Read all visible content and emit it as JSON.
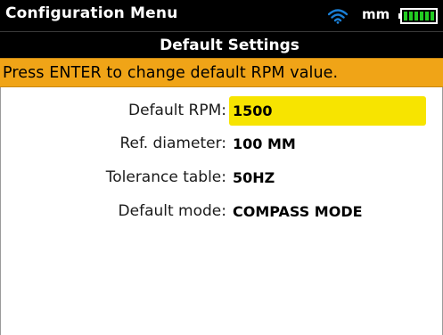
{
  "status_bar": {
    "title": "Configuration Menu",
    "units": "mm",
    "wifi_icon": "wifi-icon",
    "battery_icon": "battery-icon",
    "wifi_color": "#1a7fd6",
    "battery_color": "#22cc22"
  },
  "header": {
    "title": "Default Settings"
  },
  "hint": {
    "text": "Press ENTER to change default RPM value.",
    "color": "#f0a417"
  },
  "settings": {
    "rows": [
      {
        "label": "Default RPM:",
        "value": "1500",
        "selected": true
      },
      {
        "label": "Ref. diameter:",
        "value": "100 MM",
        "selected": false
      },
      {
        "label": "Tolerance table:",
        "value": "50HZ",
        "selected": false
      },
      {
        "label": "Default mode:",
        "value": "COMPASS MODE",
        "selected": false
      }
    ],
    "highlight_color": "#f7e400"
  }
}
